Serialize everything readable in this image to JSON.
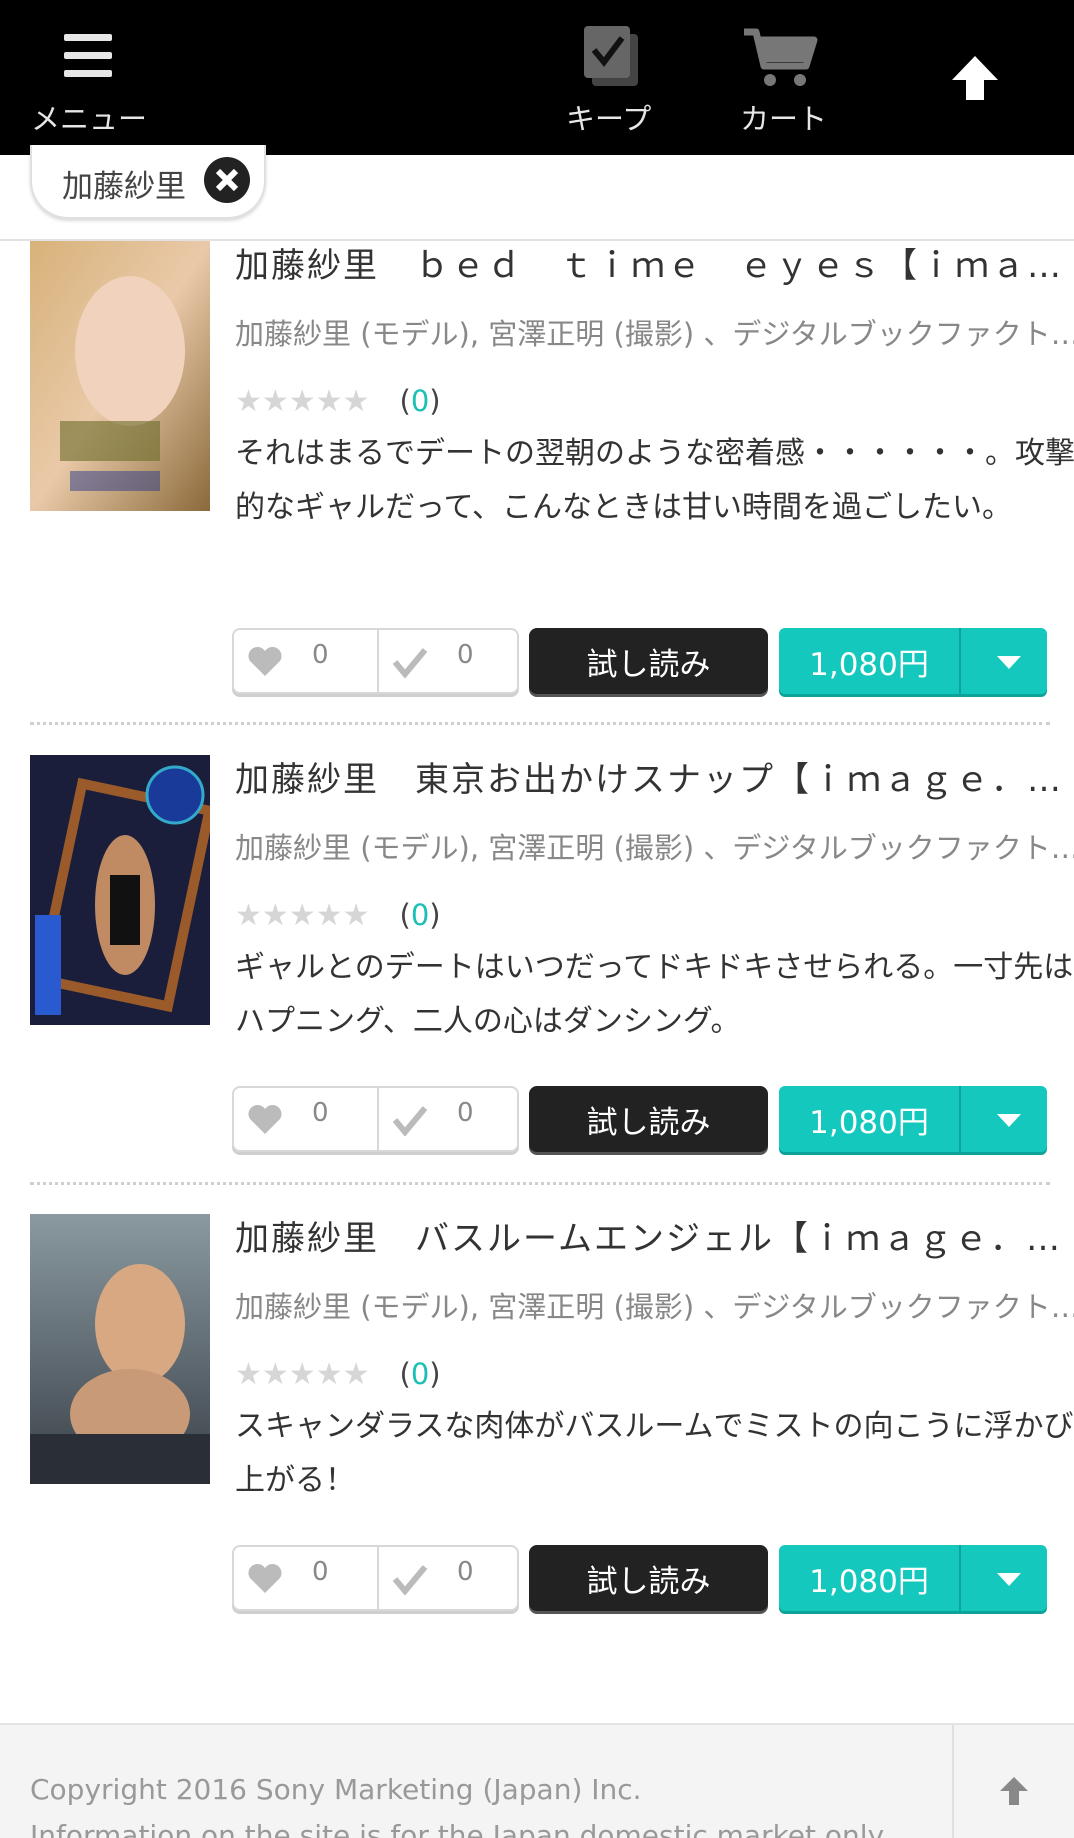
{
  "header": {
    "menu_label": "メニュー",
    "keep_label": "キープ",
    "cart_label": "カート"
  },
  "filter": {
    "chip_label": "加藤紗里"
  },
  "items": [
    {
      "title": "加藤紗里　ｂｅｄ　ｔｉｍｅ　ｅｙｅｓ【ｉｍａｇｅ．ｔｖ】",
      "authors": "加藤紗里 (モデル), 宮澤正明 (撮影) 、デジタルブックファクトリー",
      "stars": "★★★★★",
      "rating_open": "(",
      "rating_count": "0",
      "rating_close": ")",
      "description": "それはまるでデートの翌朝のような密着感・・・・・・。攻撃的なギャルだって、こんなときは甘い時間を過ごしたい。",
      "likes": "0",
      "keeps": "0",
      "try_label": "試し読み",
      "price": "1,080円"
    },
    {
      "title": "加藤紗里　東京お出かけスナップ【ｉｍａｇｅ．ｔｖ】",
      "authors": "加藤紗里 (モデル), 宮澤正明 (撮影) 、デジタルブックファクトリー",
      "stars": "★★★★★",
      "rating_open": "(",
      "rating_count": "0",
      "rating_close": ")",
      "description": "ギャルとのデートはいつだってドキドキさせられる。一寸先はハプニング、二人の心はダンシング。",
      "likes": "0",
      "keeps": "0",
      "try_label": "試し読み",
      "price": "1,080円"
    },
    {
      "title": "加藤紗里　バスルームエンジェル【ｉｍａｇｅ．ｔｖ】",
      "authors": "加藤紗里 (モデル), 宮澤正明 (撮影) 、デジタルブックファクトリー",
      "stars": "★★★★★",
      "rating_open": "(",
      "rating_count": "0",
      "rating_close": ")",
      "description": "スキャンダラスな肉体がバスルームでミストの向こうに浮かび上がる！",
      "likes": "0",
      "keeps": "0",
      "try_label": "試し読み",
      "price": "1,080円"
    }
  ],
  "footer": {
    "copyright": "Copyright 2016 Sony Marketing (Japan) Inc.",
    "notice": "Information on the site is for the Japan domestic market only."
  },
  "colors": {
    "accent": "#14c8bd",
    "header_bg": "#000000",
    "try_button": "#222222"
  },
  "icons": [
    "hamburger-menu-icon",
    "keep-check-icon",
    "cart-icon",
    "up-arrow-icon",
    "close-icon",
    "heart-icon",
    "check-icon",
    "chevron-down-icon"
  ]
}
